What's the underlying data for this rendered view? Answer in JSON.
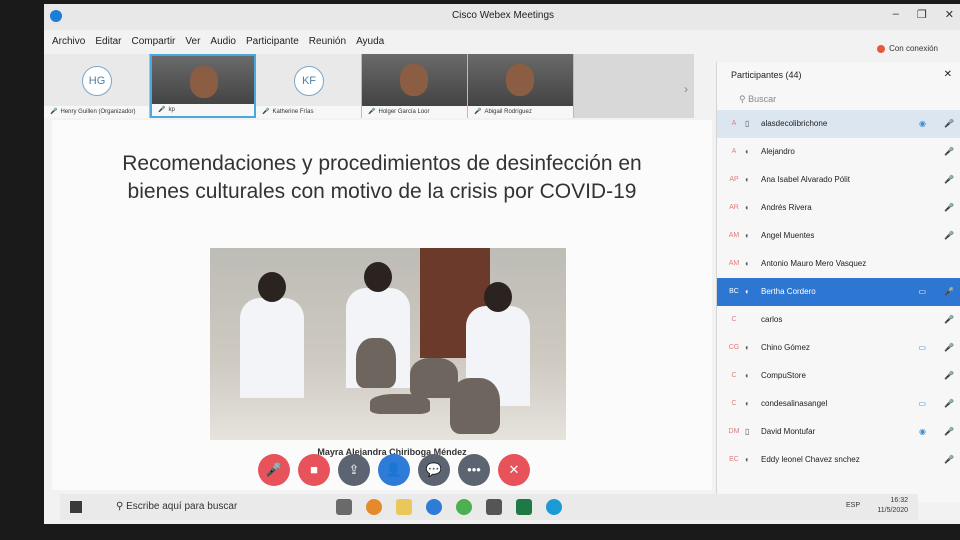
{
  "window": {
    "title": "Cisco Webex Meetings"
  },
  "menu": [
    "Archivo",
    "Editar",
    "Compartir",
    "Ver",
    "Audio",
    "Participante",
    "Reunión",
    "Ayuda"
  ],
  "connection": "Con conexión",
  "thumbnails": [
    {
      "initials": "HG",
      "name": "Henry Guillen (Organizador)",
      "camera": false
    },
    {
      "initials": "",
      "name": "kp",
      "camera": true
    },
    {
      "initials": "KF",
      "name": "Katherine Frías",
      "camera": false
    },
    {
      "initials": "",
      "name": "Holger García Loor",
      "camera": true
    },
    {
      "initials": "",
      "name": "Abigail Rodríguez",
      "camera": true
    }
  ],
  "slide": {
    "title": "Recomendaciones y procedimientos de desinfección en bienes culturales con motivo de la crisis por COVID-19",
    "caption": "Mayra Alejandra Chiriboga Méndez"
  },
  "participants_panel": {
    "title": "Participantes (44)",
    "search_placeholder": "Buscar",
    "items": [
      {
        "initials": "A",
        "name": "alasdecolibrichone"
      },
      {
        "initials": "A",
        "name": "Alejandro"
      },
      {
        "initials": "AP",
        "name": "Ana Isabel Alvarado Pólit"
      },
      {
        "initials": "AR",
        "name": "Andrés Rivera"
      },
      {
        "initials": "AM",
        "name": "Angel Muentes"
      },
      {
        "initials": "AM",
        "name": "Antonio Mauro Mero Vasquez"
      },
      {
        "initials": "BC",
        "name": "Bertha Cordero"
      },
      {
        "initials": "C",
        "name": "carlos"
      },
      {
        "initials": "CG",
        "name": "Chino Gómez"
      },
      {
        "initials": "C",
        "name": "CompuStore"
      },
      {
        "initials": "C",
        "name": "condesalinasangel"
      },
      {
        "initials": "DM",
        "name": "David Montufar"
      },
      {
        "initials": "EC",
        "name": "Eddy leonel Chavez snchez"
      }
    ]
  },
  "taskbar": {
    "search_placeholder": "Escribe aquí para buscar",
    "language": "ESP",
    "time": "16:32",
    "date": "11/5/2020"
  }
}
